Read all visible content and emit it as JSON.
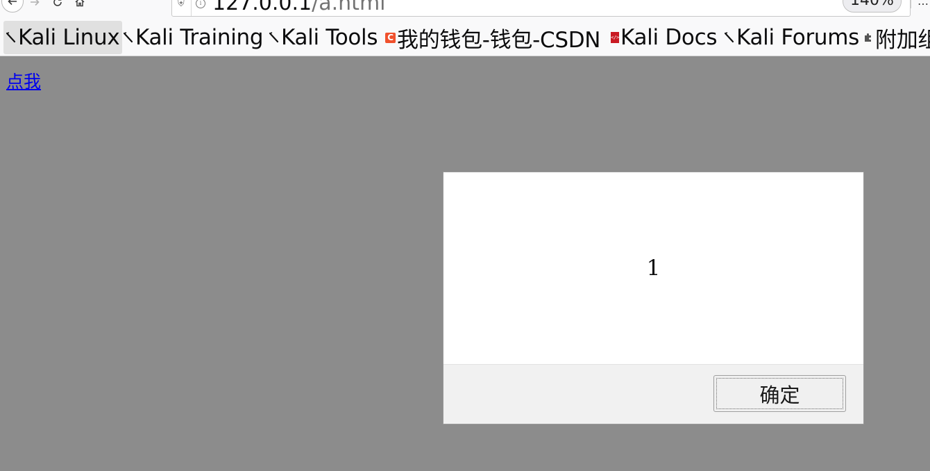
{
  "browser": {
    "url_host": "127.0.0.1",
    "url_path": "/a.html",
    "zoom": "140%",
    "icons": {
      "back": "arrow-left-icon",
      "forward": "arrow-right-icon",
      "reload": "reload-icon",
      "home": "home-icon",
      "shield": "shield-icon",
      "info": "info-icon",
      "menu": "overflow-menu-icon"
    }
  },
  "bookmarks": [
    {
      "label": "Kali Linux",
      "icon": "kali-dragon-icon",
      "active": true
    },
    {
      "label": "Kali Training",
      "icon": "kali-dragon-icon"
    },
    {
      "label": "Kali Tools",
      "icon": "kali-dragon-icon"
    },
    {
      "label": "我的钱包-钱包-CSDN",
      "icon": "csdn-icon",
      "icon_text": "C",
      "icon_color": "#f0512d"
    },
    {
      "label": "Kali Docs",
      "icon": "kali-docs-icon",
      "icon_color": "#c91a23"
    },
    {
      "label": "Kali Forums",
      "icon": "kali-dragon-icon"
    },
    {
      "label": "附加组",
      "icon": "puzzle-icon"
    }
  ],
  "page": {
    "link_text": "点我",
    "background": "#8c8c8c"
  },
  "alert": {
    "message": "1",
    "ok_label": "确定"
  }
}
